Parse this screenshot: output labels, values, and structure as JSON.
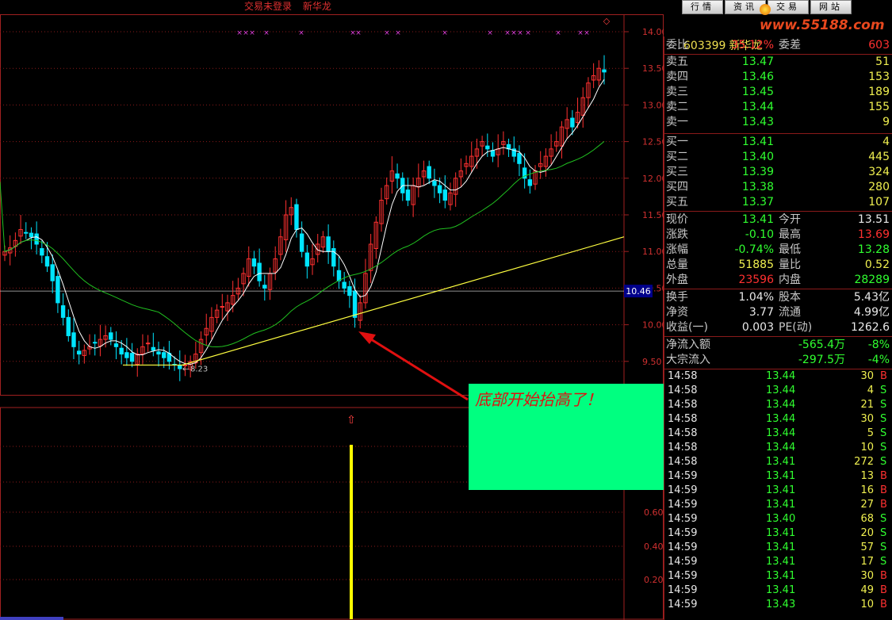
{
  "topbar": {
    "status_items": [
      "交易未登录",
      "新华龙"
    ],
    "buttons": [
      "行情",
      "资讯",
      "交易",
      "网站"
    ],
    "watermark": "www.55188.com"
  },
  "chart": {
    "y_axis_labels": [
      "14.00",
      "13.50",
      "13.00",
      "12.50",
      "12.00",
      "11.50",
      "11.00",
      "10.50",
      "10.00",
      "9.50"
    ],
    "price_marker": "10.46",
    "low_label": "8.23",
    "low_arrow": "←",
    "lower_axis_labels": [
      "0.60",
      "0.40",
      "0.20"
    ],
    "top_marks": "×",
    "top_right_icon": "◇",
    "candle_color_up": "#ff3030",
    "candle_color_down": "#00e5ff",
    "ma_short_color": "#ffffff",
    "ma_long_color": "#20c020",
    "trendline_color": "#ffff40",
    "signal_arrow": "⇧"
  },
  "callout": {
    "text": "底部开始抬高了！",
    "bg_color": "#00ff80"
  },
  "panel": {
    "code": "603399",
    "name": "新华龙",
    "weibi": {
      "label": "委比",
      "value": "35.12%",
      "label2": "委差",
      "value2": "603"
    },
    "sells": [
      {
        "label": "卖五",
        "price": "13.47",
        "vol": "51"
      },
      {
        "label": "卖四",
        "price": "13.46",
        "vol": "153"
      },
      {
        "label": "卖三",
        "price": "13.45",
        "vol": "189"
      },
      {
        "label": "卖二",
        "price": "13.44",
        "vol": "155"
      },
      {
        "label": "卖一",
        "price": "13.43",
        "vol": "9"
      }
    ],
    "buys": [
      {
        "label": "买一",
        "price": "13.41",
        "vol": "4"
      },
      {
        "label": "买二",
        "price": "13.40",
        "vol": "445"
      },
      {
        "label": "买三",
        "price": "13.39",
        "vol": "324"
      },
      {
        "label": "买四",
        "price": "13.38",
        "vol": "280"
      },
      {
        "label": "买五",
        "price": "13.37",
        "vol": "107"
      }
    ],
    "quote": [
      {
        "l1": "现价",
        "v1": "13.41",
        "c1": "g",
        "l2": "今开",
        "v2": "13.51",
        "c2": "w"
      },
      {
        "l1": "涨跌",
        "v1": "-0.10",
        "c1": "g",
        "l2": "最高",
        "v2": "13.69",
        "c2": "r"
      },
      {
        "l1": "涨幅",
        "v1": "-0.74%",
        "c1": "g",
        "l2": "最低",
        "v2": "13.28",
        "c2": "g"
      },
      {
        "l1": "总量",
        "v1": "51885",
        "c1": "y",
        "l2": "量比",
        "v2": "0.52",
        "c2": "y"
      },
      {
        "l1": "外盘",
        "v1": "23596",
        "c1": "r",
        "l2": "内盘",
        "v2": "28289",
        "c2": "g"
      }
    ],
    "finance": [
      {
        "l1": "换手",
        "v1": "1.04%",
        "l2": "股本",
        "v2": "5.43亿"
      },
      {
        "l1": "净资",
        "v1": "3.77",
        "l2": "流通",
        "v2": "4.99亿"
      },
      {
        "l1": "收益(一)",
        "v1": "0.003",
        "l2": "PE(动)",
        "v2": "1262.6"
      }
    ],
    "flows": [
      {
        "label": "净流入额",
        "value": "-565.4万",
        "pct": "-8%"
      },
      {
        "label": "大宗流入",
        "value": "-297.5万",
        "pct": "-4%"
      }
    ],
    "trades": [
      {
        "t": "14:58",
        "p": "13.44",
        "v": "30",
        "bs": "B"
      },
      {
        "t": "14:58",
        "p": "13.44",
        "v": "4",
        "bs": "S"
      },
      {
        "t": "14:58",
        "p": "13.44",
        "v": "21",
        "bs": "S"
      },
      {
        "t": "14:58",
        "p": "13.44",
        "v": "30",
        "bs": "S"
      },
      {
        "t": "14:58",
        "p": "13.44",
        "v": "5",
        "bs": "S"
      },
      {
        "t": "14:58",
        "p": "13.44",
        "v": "10",
        "bs": "S"
      },
      {
        "t": "14:58",
        "p": "13.41",
        "v": "272",
        "bs": "S"
      },
      {
        "t": "14:59",
        "p": "13.41",
        "v": "13",
        "bs": "B"
      },
      {
        "t": "14:59",
        "p": "13.41",
        "v": "16",
        "bs": "B"
      },
      {
        "t": "14:59",
        "p": "13.41",
        "v": "27",
        "bs": "B"
      },
      {
        "t": "14:59",
        "p": "13.40",
        "v": "68",
        "bs": "S"
      },
      {
        "t": "14:59",
        "p": "13.41",
        "v": "20",
        "bs": "S"
      },
      {
        "t": "14:59",
        "p": "13.41",
        "v": "57",
        "bs": "S"
      },
      {
        "t": "14:59",
        "p": "13.41",
        "v": "17",
        "bs": "S"
      },
      {
        "t": "14:59",
        "p": "13.41",
        "v": "30",
        "bs": "B"
      },
      {
        "t": "14:59",
        "p": "13.41",
        "v": "49",
        "bs": "B"
      },
      {
        "t": "14:59",
        "p": "13.43",
        "v": "10",
        "bs": "B"
      }
    ]
  }
}
